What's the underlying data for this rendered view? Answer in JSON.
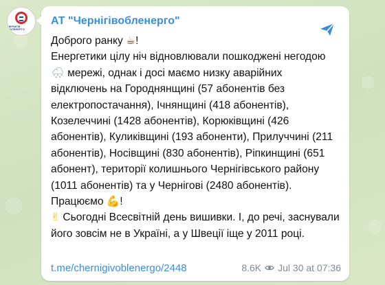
{
  "channel": {
    "name": "АТ \"Чернігівобленерго\"",
    "avatar_text": "ЧЕРНІГІВ ОБЛЕНЕРГО"
  },
  "post": {
    "greeting_text": "Доброго ранку",
    "greeting_end": "!",
    "emoji_coffee": "☕",
    "text_before_snow": "Енергетики цілу ніч відновлювали пошкоджені негодою",
    "emoji_snow": "🌨",
    "text_after_snow": "мережі, однак і досі маємо низку аварійних відключень на Городнянщині (57 абонентів без електропостачання), Ічнянщині (418 абонентів), Козелеччині (1428 абонентів), Корюківщині (426 абонентів), Куликівщині (193 абоненти), Прилуччині (211 абонентів), Носівщині (830 абонентів), Ріпкинщині (651 абонент), території колишнього Чернігівського району (1011 абонентів) та у Чернігові (2480 абонентів). Працюємо",
    "emoji_muscle": "💪",
    "exclaim": "!",
    "emoji_hand": "✌",
    "embroidery_text": "Сьогодні Всесвітній день вишивки. І, до речі, заснували його зовсім не в Україні, а у Швеції іще у 2011 році.",
    "link": "t.me/chernigivoblenergo/2448",
    "views": "8.6K",
    "date": "Jul 30 at 07:36"
  },
  "icons": {
    "share": "share-icon",
    "views": "eye-icon"
  },
  "colors": {
    "background": "#d6e6c6",
    "bubble": "#ffffff",
    "channel_name": "#3a8ed8",
    "link": "#3a8ed8",
    "meta": "#7f8b97",
    "text": "#111111"
  }
}
